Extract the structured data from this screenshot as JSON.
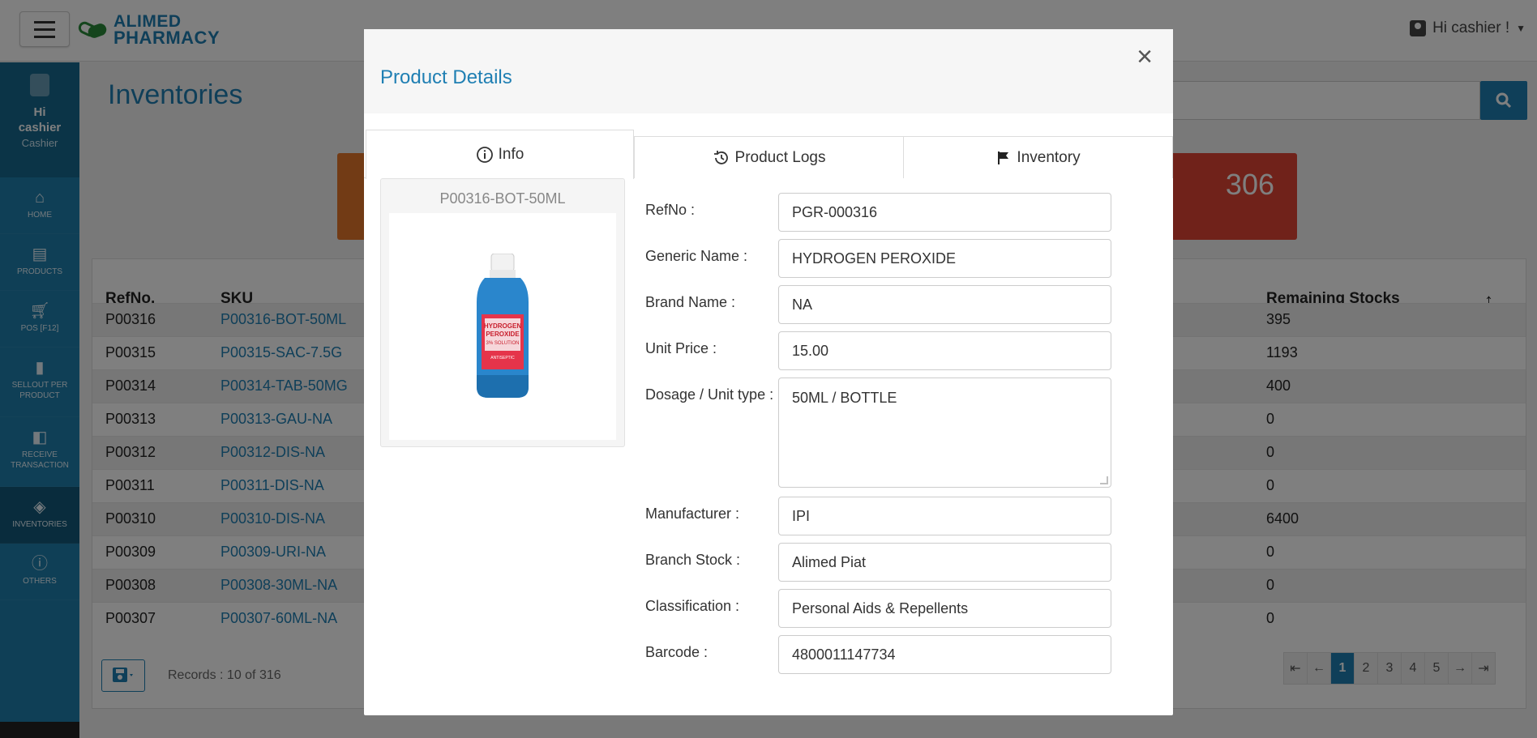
{
  "topbar": {
    "logo_line1": "ALIMED",
    "logo_line2": "PHARMACY",
    "user_greeting": "Hi cashier !"
  },
  "sidebar": {
    "user_hi": "Hi",
    "user_name": "cashier",
    "user_role": "Cashier",
    "items": [
      {
        "label": "HOME",
        "icon": "home-icon"
      },
      {
        "label": "PRODUCTS",
        "icon": "products-icon"
      },
      {
        "label": "POS [F12]",
        "icon": "cart-icon"
      },
      {
        "label": "SELLOUT PER PRODUCT",
        "icon": "book-icon"
      },
      {
        "label": "RECEIVE TRANSACTION",
        "icon": "receive-icon"
      },
      {
        "label": "INVENTORIES",
        "icon": "tag-icon"
      },
      {
        "label": "OTHERS",
        "icon": "info-icon"
      }
    ]
  },
  "page": {
    "title": "Inventories",
    "card_red_value": "306"
  },
  "table": {
    "headers": {
      "refno": "RefNo.",
      "sku": "SKU",
      "remaining": "Remaining Stocks"
    },
    "rows": [
      {
        "refno": "P00316",
        "sku": "P00316-BOT-50ML",
        "remaining": "395"
      },
      {
        "refno": "P00315",
        "sku": "P00315-SAC-7.5G",
        "remaining": "1193"
      },
      {
        "refno": "P00314",
        "sku": "P00314-TAB-50MG",
        "remaining": "400"
      },
      {
        "refno": "P00313",
        "sku": "P00313-GAU-NA",
        "remaining": "0"
      },
      {
        "refno": "P00312",
        "sku": "P00312-DIS-NA",
        "remaining": "0"
      },
      {
        "refno": "P00311",
        "sku": "P00311-DIS-NA",
        "remaining": "0"
      },
      {
        "refno": "P00310",
        "sku": "P00310-DIS-NA",
        "remaining": "6400"
      },
      {
        "refno": "P00309",
        "sku": "P00309-URI-NA",
        "remaining": "0"
      },
      {
        "refno": "P00308",
        "sku": "P00308-30ML-NA",
        "remaining": "0"
      },
      {
        "refno": "P00307",
        "sku": "P00307-60ML-NA",
        "remaining": "0"
      }
    ],
    "records_text": "Records : 10 of 316",
    "pages": [
      "1",
      "2",
      "3",
      "4",
      "5"
    ],
    "current_page": "1"
  },
  "modal": {
    "title": "Product Details",
    "tabs": [
      {
        "label": "Info",
        "icon": "info-circle-icon"
      },
      {
        "label": "Product Logs",
        "icon": "history-icon"
      },
      {
        "label": "Inventory",
        "icon": "flag-icon"
      }
    ],
    "active_tab": "Info",
    "image_caption": "P00316-BOT-50ML",
    "bottle_label": {
      "brand": "HYDROGEN",
      "name": "PEROXIDE",
      "line": "3% SOLUTION",
      "sub": "ANTISEPTIC"
    },
    "fields": {
      "refno": {
        "label": "RefNo :",
        "value": "PGR-000316"
      },
      "generic_name": {
        "label": "Generic Name :",
        "value": "HYDROGEN PEROXIDE"
      },
      "brand_name": {
        "label": "Brand Name :",
        "value": "NA"
      },
      "unit_price": {
        "label": "Unit Price :",
        "value": "15.00"
      },
      "dosage": {
        "label": "Dosage / Unit type :",
        "value": "50ML / BOTTLE"
      },
      "manufacturer": {
        "label": "Manufacturer :",
        "value": "IPI"
      },
      "branch_stock": {
        "label": "Branch Stock :",
        "value": "Alimed Piat"
      },
      "classification": {
        "label": "Classification :",
        "value": "Personal Aids & Repellents"
      },
      "barcode": {
        "label": "Barcode :",
        "value": "4800011147734"
      }
    }
  },
  "colors": {
    "brand_blue": "#1f7fb3",
    "sidebar": "#1e7fad",
    "card_orange": "#e5772b",
    "card_red": "#e04434"
  }
}
